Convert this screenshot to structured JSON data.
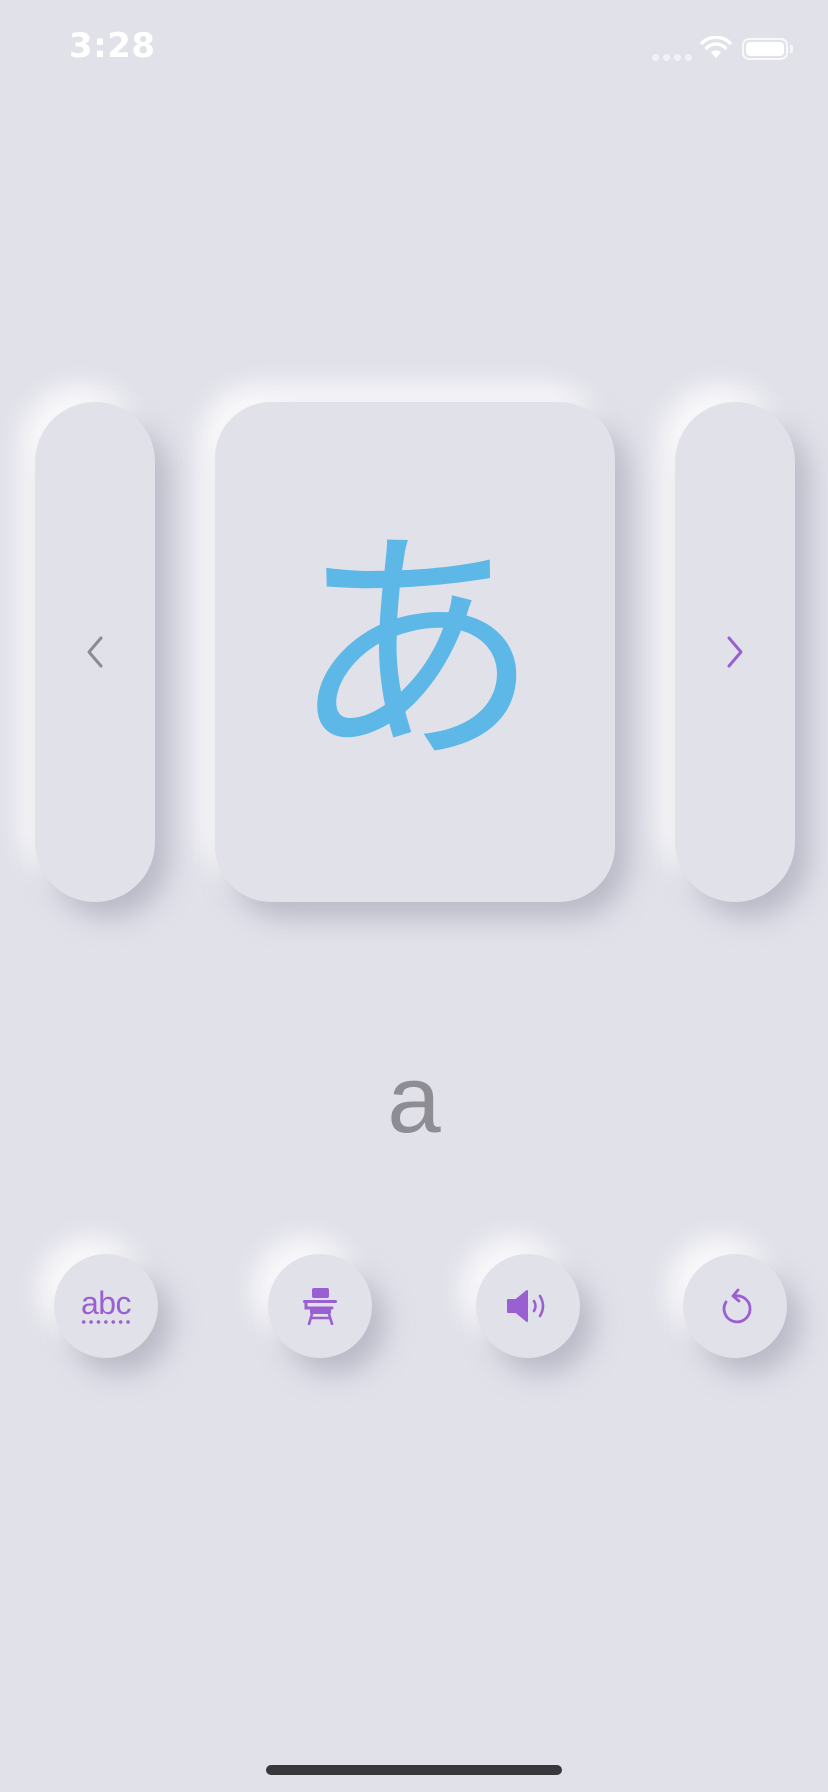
{
  "status_bar": {
    "time": "3:28",
    "icons": [
      "signal-dots-icon",
      "wifi-icon",
      "battery-icon"
    ]
  },
  "flashcard": {
    "kana": "あ",
    "romaji": "a",
    "prev_icon": "chevron-left-icon",
    "next_icon": "chevron-right-icon"
  },
  "actions": [
    {
      "name": "romaji-toggle-button",
      "icon": "abc-icon",
      "label": "abc"
    },
    {
      "name": "practice-button",
      "icon": "school-desk-icon"
    },
    {
      "name": "play-sound-button",
      "icon": "speaker-icon"
    },
    {
      "name": "reset-button",
      "icon": "rotate-icon"
    }
  ],
  "colors": {
    "background": "#e1e1ea",
    "kana": "#5db8e8",
    "accent": "#9a5fd0",
    "romaji": "#8d8d93",
    "prev_chevron": "#8a8a90"
  }
}
